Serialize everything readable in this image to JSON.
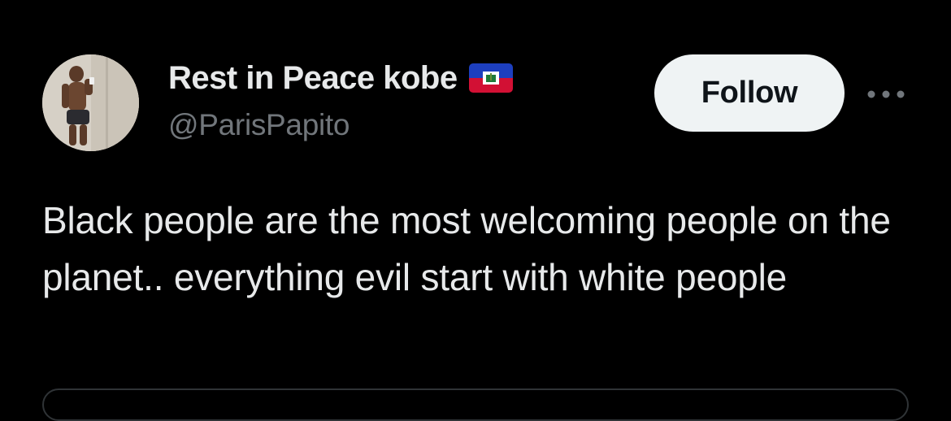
{
  "colors": {
    "background": "#000000",
    "primary_text": "#e7e9ea",
    "secondary_text": "#71767b",
    "follow_bg": "#eff3f4",
    "follow_text": "#0f1419",
    "border": "#2f3336"
  },
  "author": {
    "display_name": "Rest in Peace kobe",
    "flag_icon": "haiti-flag-emoji",
    "handle": "@ParisPapito",
    "avatar_icon": "profile-photo"
  },
  "actions": {
    "follow_label": "Follow",
    "more_icon": "more-horizontal-icon"
  },
  "tweet": {
    "text": "Black people are the most welcoming people on the planet.. everything evil start with white people"
  }
}
